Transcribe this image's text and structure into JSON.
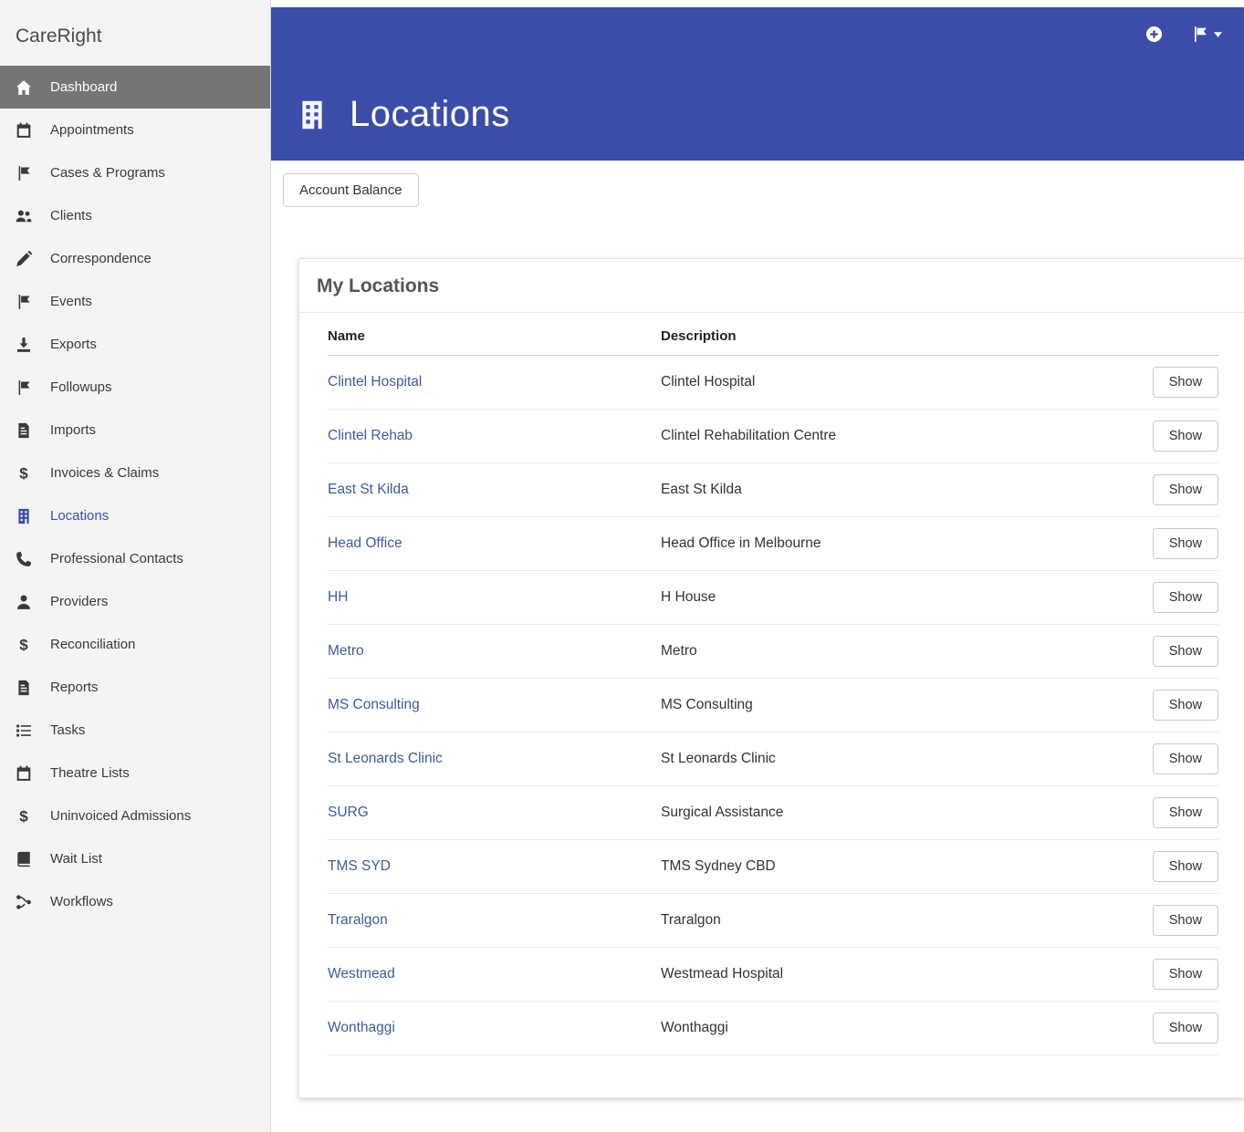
{
  "colors": {
    "header_blue": "#3b4da8",
    "link_blue": "#3e5b9e",
    "sidebar_active_bg": "#757575",
    "sidebar_bg": "#f4f4f4"
  },
  "sidebar": {
    "logo": "CareRight",
    "items": [
      {
        "label": "Dashboard",
        "icon": "home-icon",
        "state": "active"
      },
      {
        "label": "Appointments",
        "icon": "calendar-icon"
      },
      {
        "label": "Cases & Programs",
        "icon": "flag-icon"
      },
      {
        "label": "Clients",
        "icon": "users-icon"
      },
      {
        "label": "Correspondence",
        "icon": "pencil-icon"
      },
      {
        "label": "Events",
        "icon": "flag-icon"
      },
      {
        "label": "Exports",
        "icon": "download-icon"
      },
      {
        "label": "Followups",
        "icon": "flag-icon"
      },
      {
        "label": "Imports",
        "icon": "file-icon"
      },
      {
        "label": "Invoices & Claims",
        "icon": "dollar-icon"
      },
      {
        "label": "Locations",
        "icon": "building-icon",
        "state": "current"
      },
      {
        "label": "Professional Contacts",
        "icon": "phone-icon"
      },
      {
        "label": "Providers",
        "icon": "person-icon"
      },
      {
        "label": "Reconciliation",
        "icon": "dollar-icon"
      },
      {
        "label": "Reports",
        "icon": "file-icon"
      },
      {
        "label": "Tasks",
        "icon": "list-icon"
      },
      {
        "label": "Theatre Lists",
        "icon": "calendar-icon"
      },
      {
        "label": "Uninvoiced Admissions",
        "icon": "dollar-icon"
      },
      {
        "label": "Wait List",
        "icon": "book-icon"
      },
      {
        "label": "Workflows",
        "icon": "workflow-icon"
      }
    ]
  },
  "header": {
    "title": "Locations",
    "title_icon": "building-icon",
    "actions": [
      {
        "icon": "plus-circle-icon"
      },
      {
        "icon": "flag-caret-icon"
      }
    ]
  },
  "toolbar": {
    "account_balance_label": "Account Balance"
  },
  "panel": {
    "title": "My Locations",
    "columns": {
      "name": "Name",
      "description": "Description"
    },
    "show_label": "Show",
    "rows": [
      {
        "name": "Clintel Hospital",
        "description": "Clintel Hospital"
      },
      {
        "name": "Clintel Rehab",
        "description": "Clintel Rehabilitation Centre"
      },
      {
        "name": "East St Kilda",
        "description": "East St Kilda"
      },
      {
        "name": "Head Office",
        "description": "Head Office in Melbourne"
      },
      {
        "name": "HH",
        "description": "H House"
      },
      {
        "name": "Metro",
        "description": "Metro"
      },
      {
        "name": "MS Consulting",
        "description": "MS Consulting"
      },
      {
        "name": "St Leonards Clinic",
        "description": "St Leonards Clinic"
      },
      {
        "name": "SURG",
        "description": "Surgical Assistance"
      },
      {
        "name": "TMS SYD",
        "description": "TMS Sydney CBD"
      },
      {
        "name": "Traralgon",
        "description": "Traralgon"
      },
      {
        "name": "Westmead",
        "description": "Westmead Hospital"
      },
      {
        "name": "Wonthaggi",
        "description": "Wonthaggi"
      }
    ]
  }
}
